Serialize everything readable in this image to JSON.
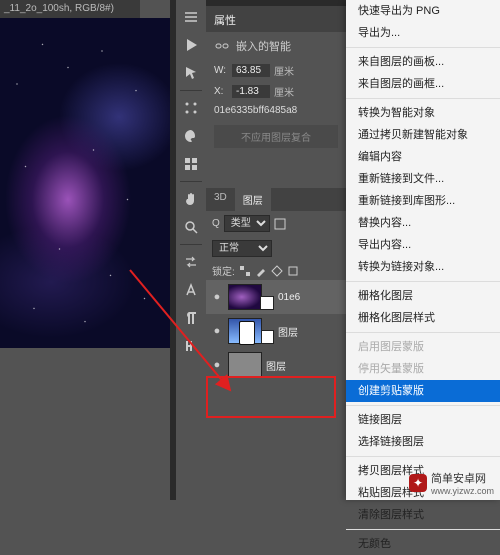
{
  "tab_title": "_11_2o_100sh, RGB/8#)",
  "properties": {
    "title": "属性",
    "embedded_label": "嵌入的智能",
    "w_label": "W:",
    "w_value": "63.85",
    "w_unit": "厘米",
    "x_label": "X:",
    "x_value": "-1.83",
    "x_unit": "厘米",
    "hash": "01e6335bff6485a8",
    "disabled_text": "不应用图层复合"
  },
  "layers": {
    "tab_3d": "3D",
    "tab_layers": "图层",
    "kind_label": "类型",
    "kind_icon": "Q",
    "blend_mode": "正常",
    "lock_label": "锁定:",
    "items": [
      {
        "name": "01e6",
        "eye": "●"
      },
      {
        "name": "图层",
        "eye": "●"
      },
      {
        "name": "图层",
        "eye": "●"
      }
    ]
  },
  "menu": {
    "items": [
      {
        "t": "快速导出为 PNG"
      },
      {
        "t": "导出为..."
      },
      {
        "sep": true
      },
      {
        "t": "来自图层的画板..."
      },
      {
        "t": "来自图层的画框..."
      },
      {
        "sep": true
      },
      {
        "t": "转换为智能对象"
      },
      {
        "t": "通过拷贝新建智能对象"
      },
      {
        "t": "编辑内容"
      },
      {
        "t": "重新链接到文件..."
      },
      {
        "t": "重新链接到库图形..."
      },
      {
        "t": "替换内容..."
      },
      {
        "t": "导出内容..."
      },
      {
        "t": "转换为链接对象..."
      },
      {
        "sep": true
      },
      {
        "t": "栅格化图层"
      },
      {
        "t": "栅格化图层样式"
      },
      {
        "sep": true
      },
      {
        "t": "启用图层蒙版",
        "disabled": true
      },
      {
        "t": "停用矢量蒙版",
        "disabled": true
      },
      {
        "t": "创建剪贴蒙版",
        "hl": true
      },
      {
        "sep": true
      },
      {
        "t": "链接图层"
      },
      {
        "t": "选择链接图层"
      },
      {
        "sep": true
      },
      {
        "t": "拷贝图层样式"
      },
      {
        "t": "粘贴图层样式"
      },
      {
        "t": "清除图层样式"
      },
      {
        "sep": true
      },
      {
        "t": "无颜色"
      }
    ]
  },
  "watermark": {
    "name": "简单安卓网",
    "url": "www.yizwz.com"
  },
  "tool_icons": [
    "play",
    "cursor",
    "dots",
    "palette",
    "grid",
    "hand",
    "zoom",
    "swap",
    "text",
    "para",
    "space"
  ]
}
